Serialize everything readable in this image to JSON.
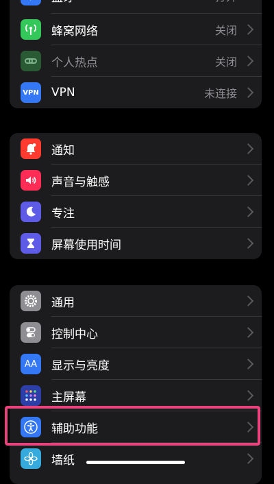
{
  "group1": {
    "rows": [
      {
        "label": "蓝牙",
        "value": "打开"
      },
      {
        "label": "蜂窝网络",
        "value": "关闭"
      },
      {
        "label": "个人热点",
        "value": "关闭"
      },
      {
        "label": "VPN",
        "value": "未连接",
        "icon_text": "VPN"
      }
    ]
  },
  "group2": {
    "rows": [
      {
        "label": "通知"
      },
      {
        "label": "声音与触感"
      },
      {
        "label": "专注"
      },
      {
        "label": "屏幕使用时间"
      }
    ]
  },
  "group3": {
    "rows": [
      {
        "label": "通用"
      },
      {
        "label": "控制中心"
      },
      {
        "label": "显示与亮度",
        "icon_text": "AA"
      },
      {
        "label": "主屏幕"
      },
      {
        "label": "辅助功能"
      },
      {
        "label": "墙纸"
      }
    ]
  },
  "colors": {
    "background": "#000000",
    "group": "#1c1c1e",
    "highlight": "#e8437d",
    "blue": "#3478f6",
    "green": "#34c759",
    "red": "#ff3b30",
    "indigo": "#5e5ce6",
    "gray": "#8e8e93"
  }
}
